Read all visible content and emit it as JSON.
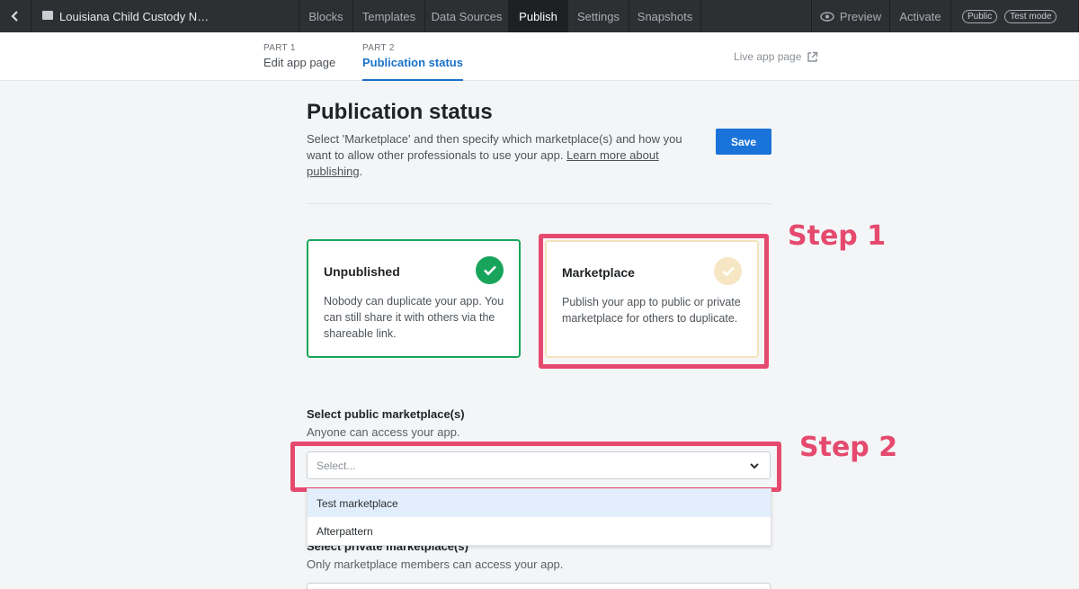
{
  "topbar": {
    "app_title": "Louisiana Child Custody N…",
    "tabs": [
      {
        "label": "Blocks"
      },
      {
        "label": "Templates"
      },
      {
        "label": "Data Sources"
      },
      {
        "label": "Publish",
        "active": true
      },
      {
        "label": "Settings"
      },
      {
        "label": "Snapshots"
      }
    ],
    "preview_label": "Preview",
    "activate_label": "Activate",
    "public_badge": "Public",
    "test_mode_badge": "Test mode"
  },
  "subnav": {
    "part1": {
      "kicker": "PART 1",
      "label": "Edit app page"
    },
    "part2": {
      "kicker": "PART 2",
      "label": "Publication status"
    },
    "live_link": "Live app page"
  },
  "main": {
    "heading": "Publication status",
    "description_prefix": "Select 'Marketplace' and then specify which marketplace(s) and how you want to allow other professionals to use your app.",
    "learn_more": "Learn more about publishing",
    "description_suffix": ".",
    "save_label": "Save"
  },
  "cards": {
    "unpublished": {
      "title": "Unpublished",
      "body": "Nobody can duplicate your app. You can still share it with others via the shareable link.",
      "selected": true
    },
    "marketplace": {
      "title": "Marketplace",
      "body": "Publish your app to public or private marketplace for others to duplicate.",
      "selected": false
    }
  },
  "annotations": {
    "step1": "Step 1",
    "step2": "Step 2"
  },
  "public_marketplace": {
    "label": "Select public marketplace(s)",
    "hint": "Anyone can access your app.",
    "placeholder": "Select...",
    "options": [
      "Test marketplace",
      "Afterpattern"
    ],
    "highlighted_option": "Test marketplace"
  },
  "private_marketplace": {
    "label": "Select private marketplace(s)",
    "hint": "Only marketplace members can access your app."
  },
  "colors": {
    "accent": "#1a73d9",
    "success": "#18a55b",
    "annotation": "#e54a6e",
    "topbar": "#2d3033"
  },
  "icons": {
    "back": "chevron-left-icon",
    "doc": "document-icon",
    "preview": "eye-icon",
    "external": "external-link-icon",
    "check": "check-icon",
    "dropdown": "chevron-down-icon"
  }
}
